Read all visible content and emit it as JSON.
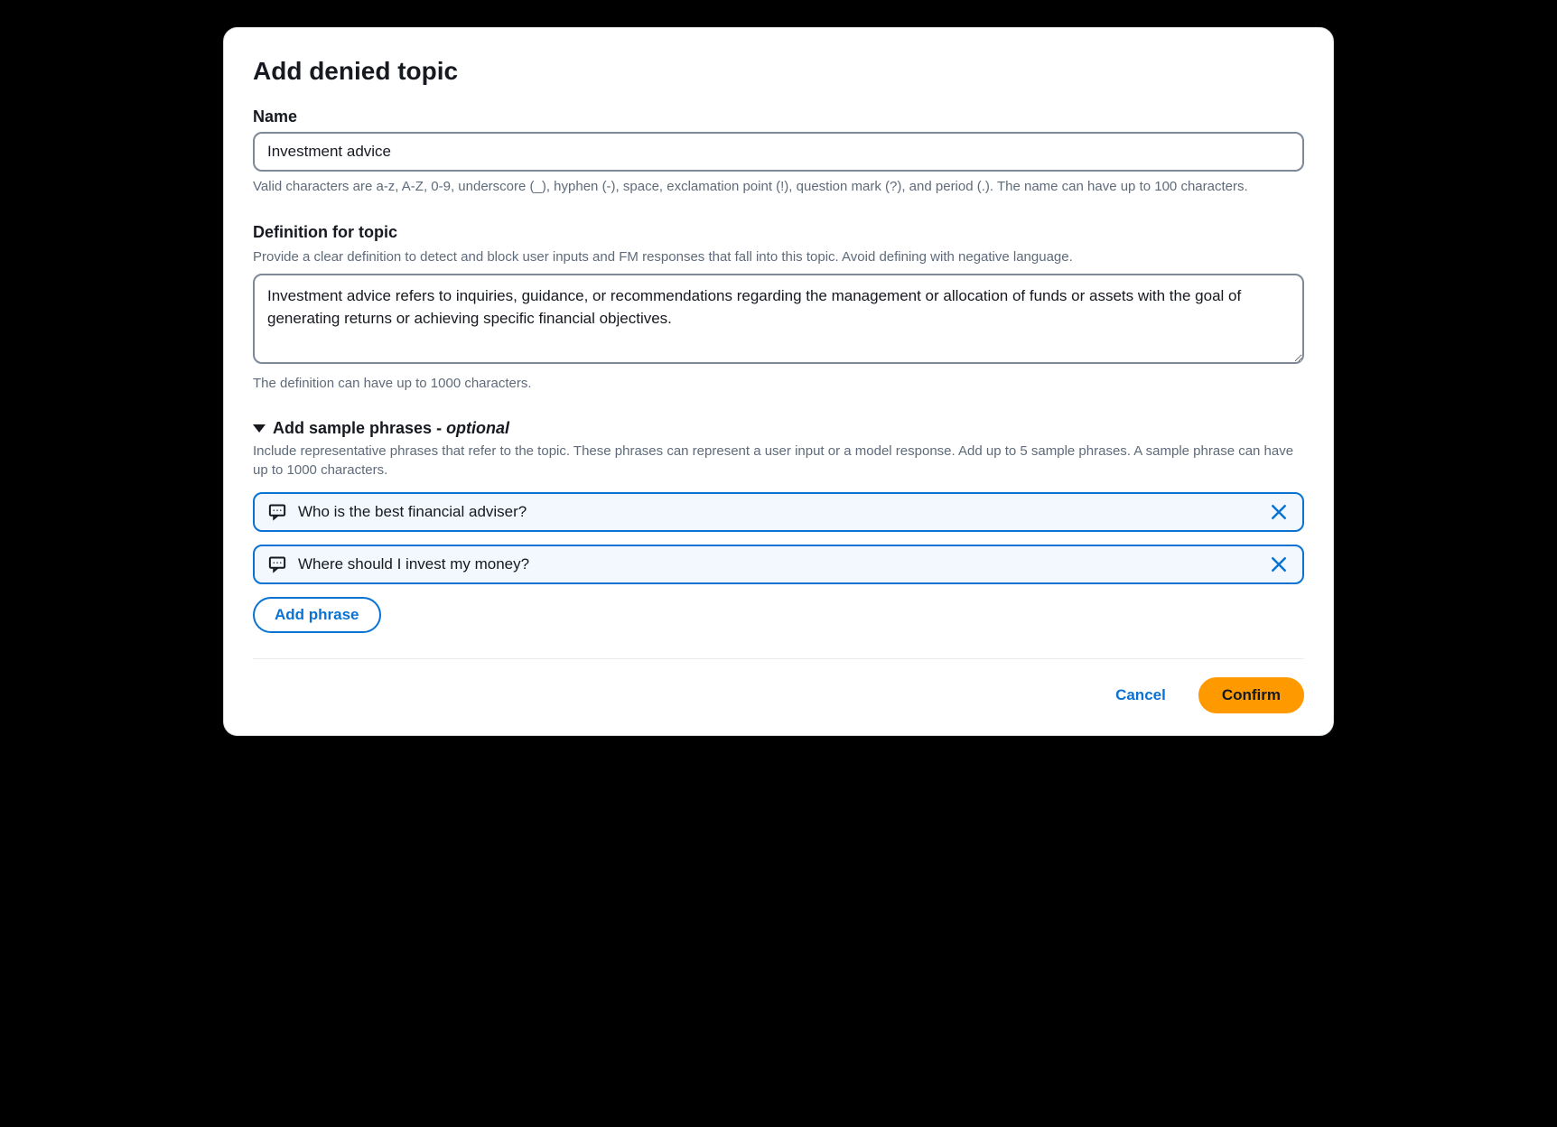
{
  "modal": {
    "title": "Add denied topic"
  },
  "name_field": {
    "label": "Name",
    "value": "Investment advice",
    "hint": "Valid characters are a-z, A-Z, 0-9, underscore (_), hyphen (-), space, exclamation point (!), question mark (?), and period (.). The name can have up to 100 characters."
  },
  "definition_field": {
    "label": "Definition for topic",
    "sublabel": "Provide a clear definition to detect and block user inputs and FM responses that fall into this topic. Avoid defining with negative language.",
    "value": "Investment advice refers to inquiries, guidance, or recommendations regarding the management or allocation of funds or assets with the goal of generating returns or achieving specific financial objectives.",
    "hint": "The definition can have up to 1000 characters."
  },
  "phrases_section": {
    "title_prefix": "Add sample phrases - ",
    "title_suffix": "optional",
    "sublabel": "Include representative phrases that refer to the topic. These phrases can represent a user input or a model response. Add up to 5 sample phrases. A sample phrase can have up to 1000 characters.",
    "phrases": [
      "Who is the best financial adviser?",
      "Where should I invest my money?"
    ],
    "add_button": "Add phrase"
  },
  "footer": {
    "cancel": "Cancel",
    "confirm": "Confirm"
  }
}
